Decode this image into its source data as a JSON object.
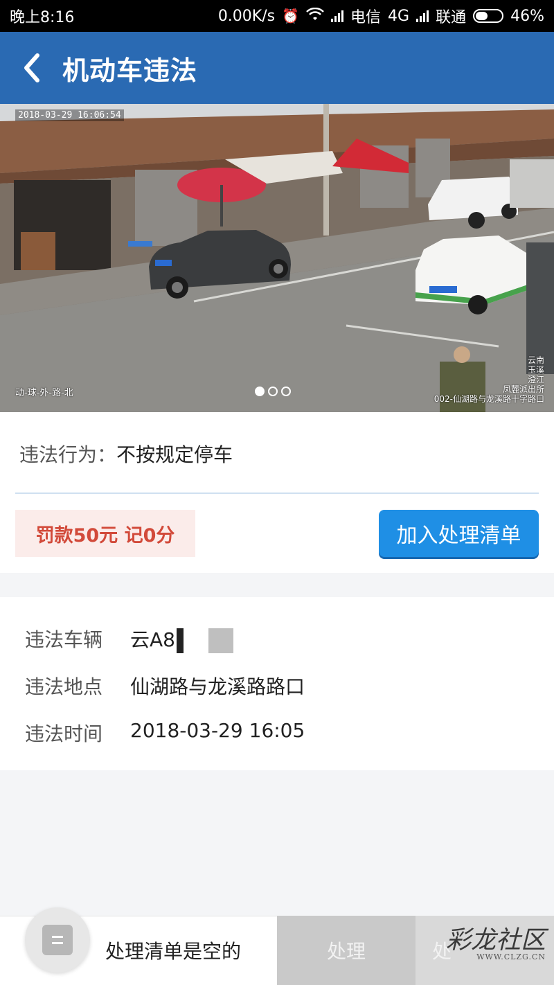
{
  "status_bar": {
    "time": "晚上8:16",
    "network_speed": "0.00K/s",
    "carrier1": "电信",
    "network_type": "4G",
    "carrier2": "联通",
    "battery": "46%",
    "battery_level": 0.46
  },
  "header": {
    "title": "机动车违法",
    "back_icon": "chevron-left-icon"
  },
  "photo": {
    "timestamp": "2018-03-29 16:06:54",
    "left_label": "动-球-外-路-北",
    "right_label_lines": [
      "云南",
      "玉溪",
      "澄江",
      "凤麓派出所",
      "002-仙湖路与龙溪路十字路口"
    ],
    "pager_total": 3,
    "pager_active": 1
  },
  "violation": {
    "behavior_label": "违法行为：",
    "behavior_value": "不按规定停车",
    "fine_text": "罚款50元 记0分",
    "add_button": "加入处理清单"
  },
  "details": {
    "vehicle_label": "违法车辆",
    "vehicle_value": "云A8",
    "location_label": "违法地点",
    "location_value": "仙湖路与龙溪路路口",
    "time_label": "违法时间",
    "time_value": "2018-03-29 16:05"
  },
  "bottom": {
    "empty_text": "处理清单是空的",
    "process_label": "处理",
    "process_label_2": "处",
    "watermark": "彩龙社区",
    "watermark_url": "WWW.CLZG.CN"
  }
}
